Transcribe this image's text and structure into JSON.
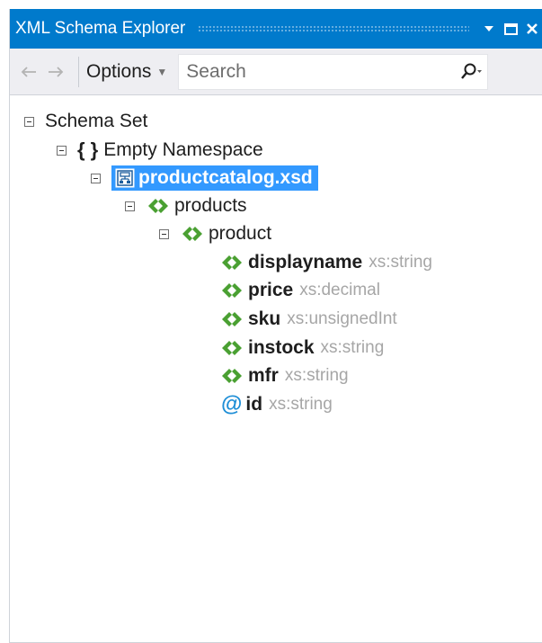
{
  "window": {
    "title": "XML Schema Explorer",
    "accent": "#007acc",
    "buttons": [
      "dropdown-arrow-icon",
      "maximize-icon",
      "close-icon"
    ]
  },
  "toolbar": {
    "back_icon": "back-arrow-icon",
    "forward_icon": "forward-arrow-icon",
    "options_label": "Options",
    "search_placeholder": "Search",
    "search_value": "",
    "search_icon": "search-icon"
  },
  "tree": {
    "selection_color": "#3399ff",
    "element_icon_color": "#4aa032",
    "attribute_icon_color": "#1e8ed6",
    "root": {
      "label": "Schema Set",
      "expanded": true
    },
    "namespace": {
      "icon": "braces-icon",
      "label": "Empty Namespace",
      "expanded": true
    },
    "file": {
      "icon": "schema-file-icon",
      "label": "productcatalog.xsd",
      "expanded": true,
      "selected": true
    },
    "products": {
      "icon": "element-icon",
      "label": "products",
      "expanded": true
    },
    "product": {
      "icon": "element-icon",
      "label": "product",
      "expanded": true
    },
    "children": [
      {
        "icon": "element-icon",
        "name": "displayname",
        "type": "xs:string"
      },
      {
        "icon": "element-icon",
        "name": "price",
        "type": "xs:decimal"
      },
      {
        "icon": "element-icon",
        "name": "sku",
        "type": "xs:unsignedInt"
      },
      {
        "icon": "element-icon",
        "name": "instock",
        "type": "xs:string"
      },
      {
        "icon": "element-icon",
        "name": "mfr",
        "type": "xs:string"
      },
      {
        "icon": "attribute-icon",
        "name": "id",
        "type": "xs:string"
      }
    ]
  }
}
